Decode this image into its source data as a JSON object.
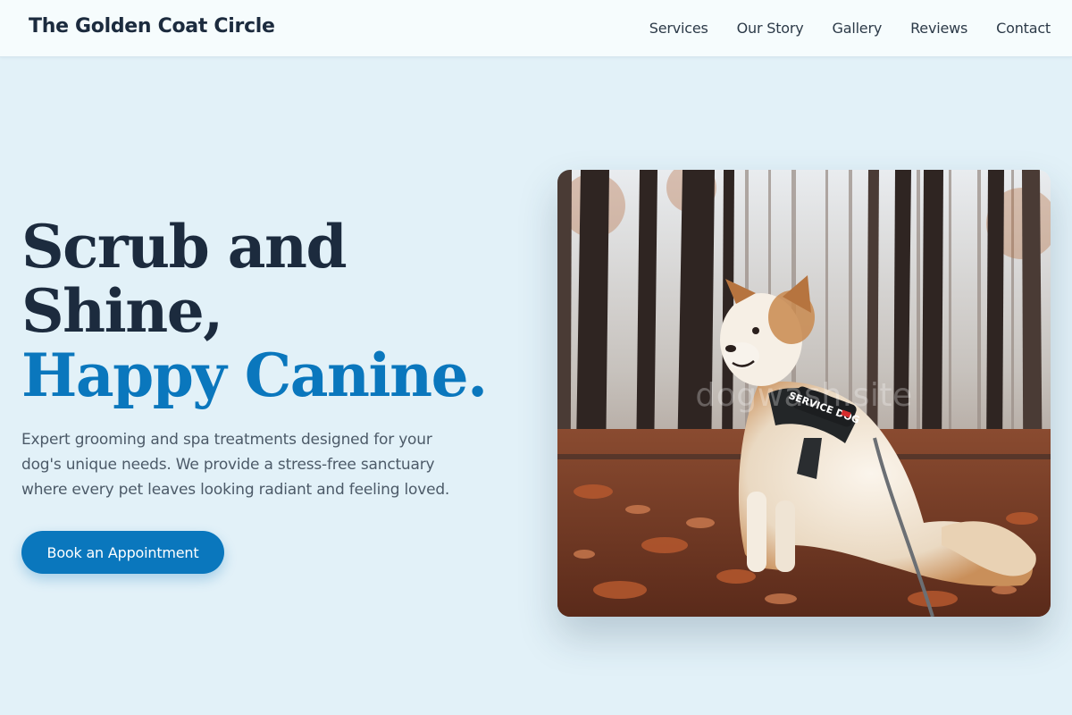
{
  "header": {
    "brand": "The Golden Coat Circle",
    "nav": [
      "Services",
      "Our Story",
      "Gallery",
      "Reviews",
      "Contact"
    ]
  },
  "hero": {
    "headline_line1": "Scrub and",
    "headline_line2": "Shine,",
    "headline_accent": "Happy Canine.",
    "description": "Expert grooming and spa treatments designed for your dog's unique needs. We provide a stress-free sanctuary where every pet leaves looking radiant and feeling loved.",
    "cta_label": "Book an Appointment"
  },
  "photo": {
    "harness_text": "SERVICE DOG",
    "watermark": "dogwash.site"
  },
  "colors": {
    "page_background": "#e2f1f8",
    "header_background": "#f6fcfd",
    "heading": "#1c2b3e",
    "accent": "#0a77bd",
    "body_text": "#4c5a68"
  }
}
